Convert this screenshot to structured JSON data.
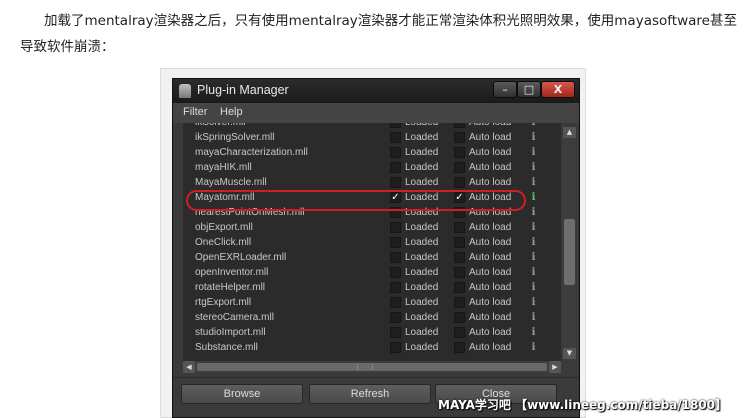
{
  "article": {
    "paragraph": "加载了mentalray渲染器之后，只有使用mentalray渲染器才能正常渲染体积光照明效果，使用mayasoftware甚至导致软件崩溃："
  },
  "window": {
    "title": "Plug-in Manager",
    "controls": {
      "minimize": "–",
      "maximize": "□",
      "close": "X"
    }
  },
  "menu": [
    "Filter",
    "Help"
  ],
  "columns": {
    "loaded_label": "Loaded",
    "autoload_label": "Auto load"
  },
  "plugins": [
    {
      "name": "ikSolver.mll",
      "loaded": false,
      "autoload": false,
      "partial": true
    },
    {
      "name": "ikSpringSolver.mll",
      "loaded": false,
      "autoload": false
    },
    {
      "name": "mayaCharacterization.mll",
      "loaded": false,
      "autoload": false
    },
    {
      "name": "mayaHIK.mll",
      "loaded": false,
      "autoload": false
    },
    {
      "name": "MayaMuscle.mll",
      "loaded": false,
      "autoload": false
    },
    {
      "name": "Mayatomr.mll",
      "loaded": true,
      "autoload": true,
      "highlighted": true
    },
    {
      "name": "nearestPointOnMesh.mll",
      "loaded": false,
      "autoload": false
    },
    {
      "name": "objExport.mll",
      "loaded": false,
      "autoload": false
    },
    {
      "name": "OneClick.mll",
      "loaded": false,
      "autoload": false
    },
    {
      "name": "OpenEXRLoader.mll",
      "loaded": false,
      "autoload": false
    },
    {
      "name": "openInventor.mll",
      "loaded": false,
      "autoload": false
    },
    {
      "name": "rotateHelper.mll",
      "loaded": false,
      "autoload": false
    },
    {
      "name": "rtgExport.mll",
      "loaded": false,
      "autoload": false
    },
    {
      "name": "stereoCamera.mll",
      "loaded": false,
      "autoload": false
    },
    {
      "name": "studioImport.mll",
      "loaded": false,
      "autoload": false
    },
    {
      "name": "Substance.mll",
      "loaded": false,
      "autoload": false
    }
  ],
  "info_glyph": "i",
  "check_glyph": "✓",
  "buttons": {
    "browse": "Browse",
    "refresh": "Refresh",
    "close": "Close"
  },
  "watermark": "MAYA学习吧 【www.lineeg.com/tieba/1800】",
  "colors": {
    "highlight": "#d21e1e",
    "panel_bg": "#2b2b2b",
    "window_bg": "#3a3a3a"
  }
}
